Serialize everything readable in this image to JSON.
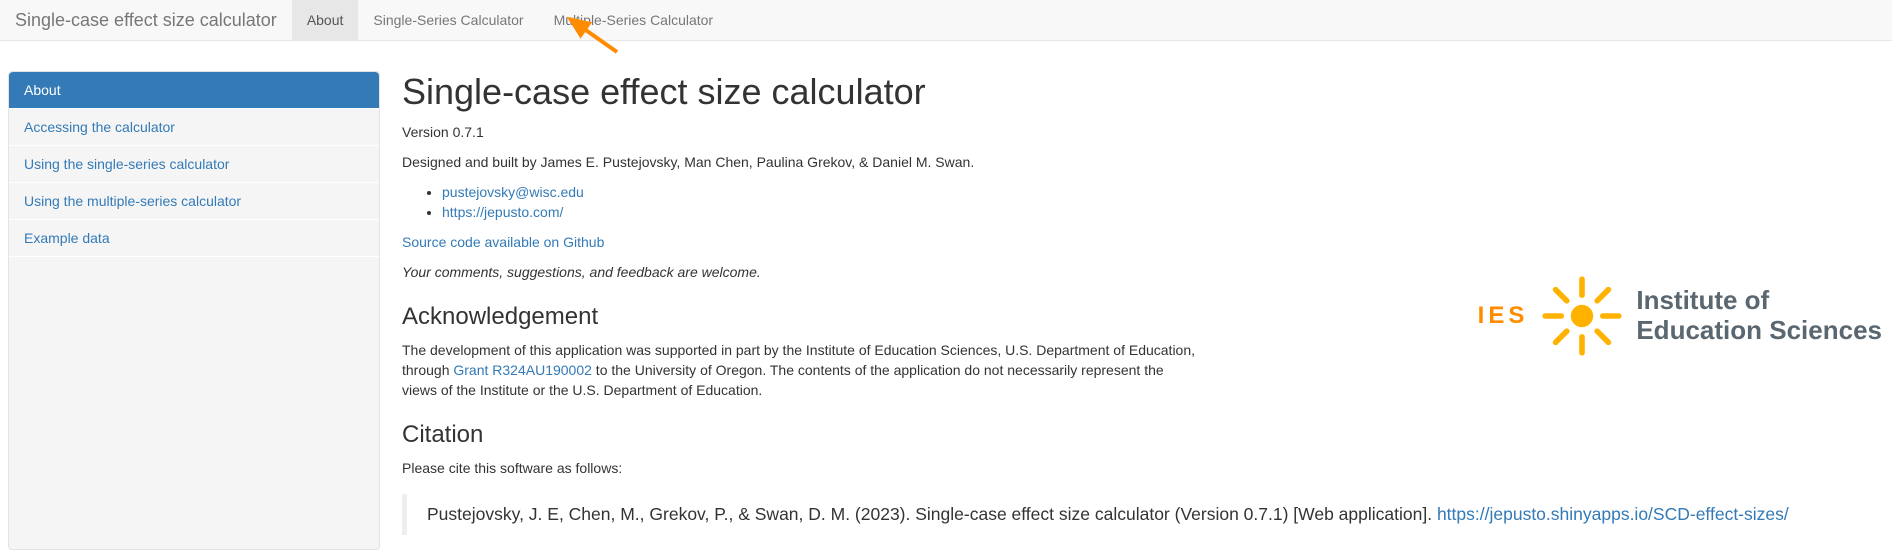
{
  "navbar": {
    "brand": "Single-case effect size calculator",
    "tabs": [
      {
        "label": "About",
        "active": true
      },
      {
        "label": "Single-Series Calculator",
        "active": false
      },
      {
        "label": "Multiple-Series Calculator",
        "active": false
      }
    ]
  },
  "sidebar": {
    "items": [
      {
        "label": "About",
        "active": true
      },
      {
        "label": "Accessing the calculator",
        "active": false
      },
      {
        "label": "Using the single-series calculator",
        "active": false
      },
      {
        "label": "Using the multiple-series calculator",
        "active": false
      },
      {
        "label": "Example data",
        "active": false
      }
    ]
  },
  "main": {
    "title": "Single-case effect size calculator",
    "version": "Version 0.7.1",
    "byline": "Designed and built by James E. Pustejovsky, Man Chen, Paulina Grekov, & Daniel M. Swan.",
    "contacts": [
      "pustejovsky@wisc.edu",
      "https://jepusto.com/"
    ],
    "source_link": "Source code available on Github",
    "feedback": "Your comments, suggestions, and feedback are welcome.",
    "ack_heading": "Acknowledgement",
    "ack_pre": "The development of this application was supported in part by the Institute of Education Sciences, U.S. Department of Education, through ",
    "ack_link": "Grant R324AU190002",
    "ack_post": " to the University of Oregon. The contents of the application do not necessarily represent the views of the Institute or the U.S. Department of Education.",
    "cite_heading": "Citation",
    "cite_intro": "Please cite this software as follows:",
    "cite_text": "Pustejovsky, J. E, Chen, M., Grekov, P., & Swan, D. M. (2023). Single-case effect size calculator (Version 0.7.1) [Web application]. ",
    "cite_url": "https://jepusto.shinyapps.io/SCD-effect-sizes/"
  },
  "logo": {
    "acronym": "IES",
    "name_line1": "Institute of",
    "name_line2": "Education Sciences"
  }
}
